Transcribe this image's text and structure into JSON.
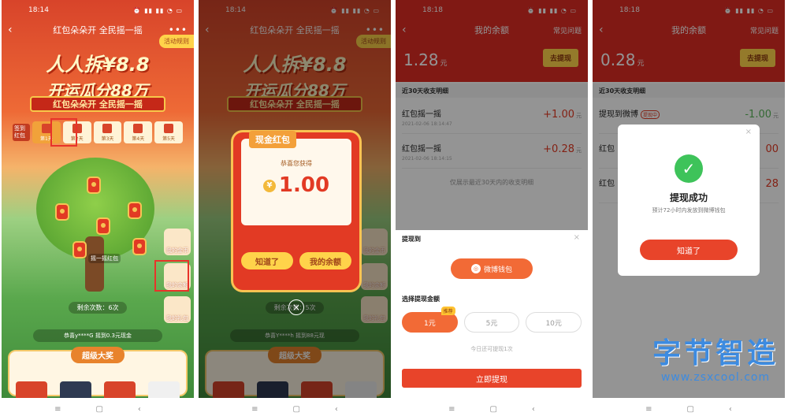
{
  "status": {
    "time": "18:14",
    "time2": "18:18",
    "icons": "⏰ ▮▮ ▮▮ ◔ ▭"
  },
  "screen1": {
    "header_title": "红包朵朵开 全民摇一摇",
    "rules": "活动规则",
    "title_line1": "人人拆¥8.8",
    "title_line2": "开运瓜分88万",
    "ribbon": "红包朵朵开 全民摇一摇",
    "progress_label": "签到红包",
    "days": [
      "第1天",
      "第2天",
      "第3天",
      "第4天",
      "第5天"
    ],
    "tree_label": "摇一摇红包",
    "side_buttons": [
      "我的金币",
      "我的余额",
      "我的礼包"
    ],
    "remaining": "剩余次数：6次",
    "ticker": "恭喜y****G 摇到0.3元现金",
    "prize_title": "超级大奖"
  },
  "screen2": {
    "header_title": "红包朵朵开 全民摇一摇",
    "rules": "活动规则",
    "env_tag": "现金红包",
    "env_msg": "恭喜您获得",
    "amount": "1.00",
    "coin": "¥",
    "btn_ok": "知道了",
    "btn_balance": "我的余额",
    "remaining": "剩余次数：5次",
    "ticker": "恭喜Y****h 摇到88元现",
    "prize_title": "超级大奖",
    "side_buttons": [
      "我的金币",
      "我的余额",
      "我的礼包"
    ]
  },
  "screen3": {
    "header_title": "我的余额",
    "help": "常见问题",
    "balance": "1.28",
    "unit": "元",
    "withdraw": "去提现",
    "section": "近30天收支明细",
    "rows": [
      {
        "name": "红包摇一摇",
        "date": "2021-02-06 18:14:47",
        "amount": "+1.00"
      },
      {
        "name": "红包摇一摇",
        "date": "2021-02-06 18:14:15",
        "amount": "+0.28"
      }
    ],
    "note": "仅展示最近30天内的收支明细",
    "sheet_to": "提现到",
    "wallet": "微博钱包",
    "choose": "选择提现金额",
    "options": [
      "1元",
      "5元",
      "10元"
    ],
    "badge": "推荐",
    "today": "今日还可提现1次",
    "confirm": "立即提现"
  },
  "screen4": {
    "header_title": "我的余额",
    "help": "常见问题",
    "balance": "0.28",
    "unit": "元",
    "withdraw": "去提现",
    "section": "近30天收支明细",
    "rows": [
      {
        "name": "提现到微博",
        "tag": "提现中",
        "amount": "-1.00"
      },
      {
        "name": "红包",
        "amount": "00"
      },
      {
        "name": "红包",
        "amount": "28"
      }
    ],
    "modal_title": "提现成功",
    "modal_sub": "预计72小时内发放到微博钱包",
    "modal_btn": "知道了",
    "watermark_cn": "字节智造",
    "watermark_url": "www.zsxcool.com"
  },
  "nav": [
    "≡",
    "▢",
    "‹"
  ]
}
